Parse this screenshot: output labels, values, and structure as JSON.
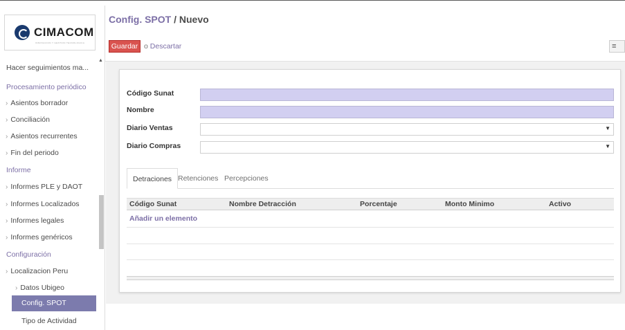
{
  "logo": {
    "name": "CIMACOM",
    "tagline": "INNOVACION Y GESTION TECNOLOGICA"
  },
  "sidebar": {
    "items": [
      {
        "label": "Hacer seguimientos ma...",
        "type": "item"
      },
      {
        "label": "Procesamiento periódico",
        "type": "section"
      },
      {
        "label": "Asientos borrador",
        "type": "sub"
      },
      {
        "label": "Conciliación",
        "type": "sub"
      },
      {
        "label": "Asientos recurrentes",
        "type": "sub"
      },
      {
        "label": "Fin del periodo",
        "type": "sub"
      },
      {
        "label": "Informe",
        "type": "section"
      },
      {
        "label": "Informes PLE y DAOT",
        "type": "sub"
      },
      {
        "label": "Informes Localizados",
        "type": "sub"
      },
      {
        "label": "Informes legales",
        "type": "sub"
      },
      {
        "label": "Informes genéricos",
        "type": "sub"
      },
      {
        "label": "Configuración",
        "type": "section"
      },
      {
        "label": "Localizacion Peru",
        "type": "sub"
      },
      {
        "label": "Datos Ubigeo",
        "type": "subsub"
      },
      {
        "label": "Config. SPOT",
        "type": "active"
      },
      {
        "label": "Tipo de Actividad",
        "type": "item"
      }
    ]
  },
  "header": {
    "breadcrumb_parent": "Config. SPOT",
    "breadcrumb_sep": " / ",
    "breadcrumb_current": "Nuevo",
    "save_label": "Guardar",
    "or_label": "o ",
    "discard_label": "Descartar",
    "view_switch_icon": "list-view-icon"
  },
  "form": {
    "fields": [
      {
        "label": "Código Sunat",
        "value": "",
        "kind": "text-required"
      },
      {
        "label": "Nombre",
        "value": "",
        "kind": "text-required"
      },
      {
        "label": "Diario Ventas",
        "value": "",
        "kind": "select"
      },
      {
        "label": "Diario Compras",
        "value": "",
        "kind": "select"
      }
    ],
    "tabs": [
      "Detraciones",
      "Retenciones",
      "Percepciones"
    ],
    "active_tab": "Detraciones",
    "grid": {
      "columns": [
        "Código Sunat",
        "Nombre Detracción",
        "Porcentaje",
        "Monto Minimo",
        "Activo"
      ],
      "add_label": "Añadir un elemento",
      "rows": []
    }
  },
  "colors": {
    "accent": "#7c6fa6",
    "active_menu": "#7c7bad",
    "save_button": "#d9534f",
    "required_field": "#d2cff1"
  }
}
